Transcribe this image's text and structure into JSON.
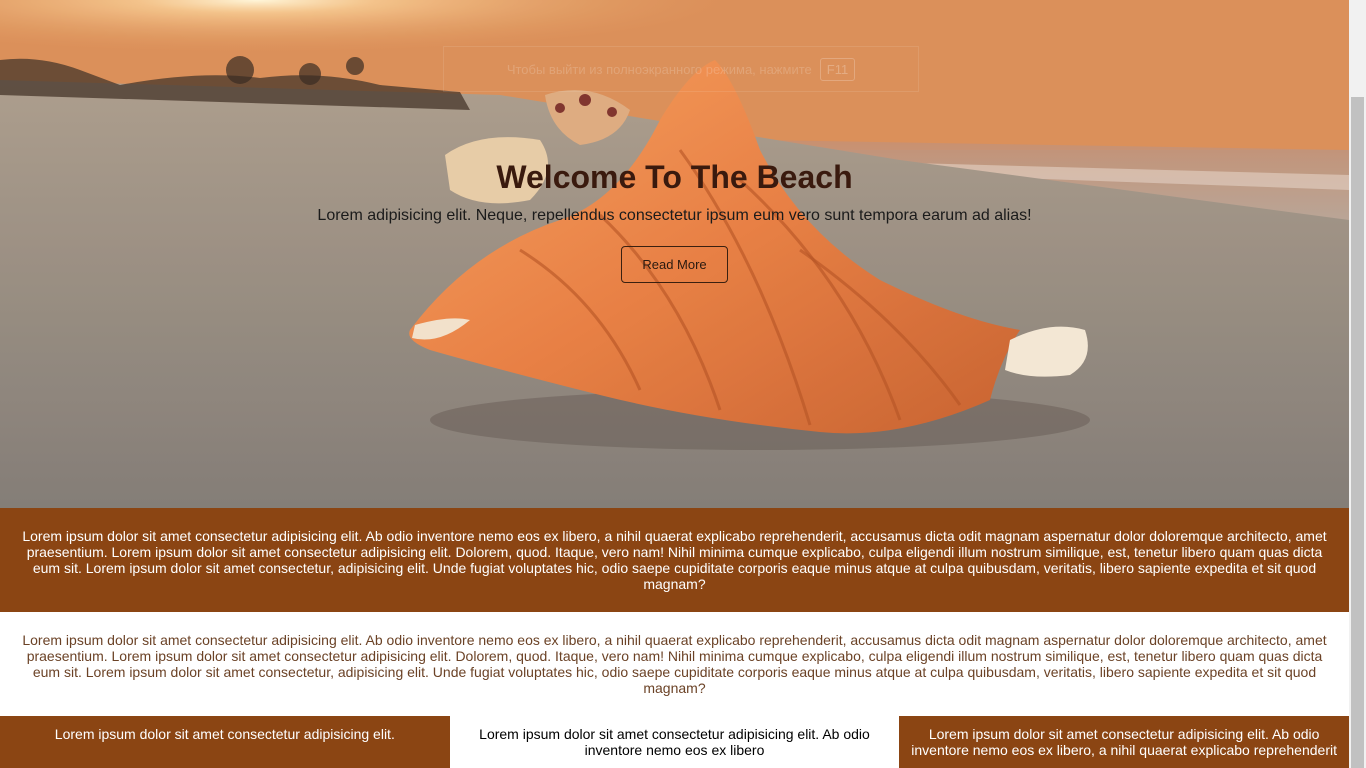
{
  "hero": {
    "notice_text": "Чтобы выйти из полноэкранного режима, нажмите",
    "notice_key": "F11",
    "title": "Welcome To The Beach",
    "subtitle": "Lorem adipisicing elit. Neque, repellendus consectetur ipsum eum vero sunt tempora earum ad alias!",
    "button_label": "Read More"
  },
  "sections": {
    "brown_text": "Lorem ipsum dolor sit amet consectetur adipisicing elit. Ab odio inventore nemo eos ex libero, a nihil quaerat explicabo reprehenderit, accusamus dicta odit magnam aspernatur dolor doloremque architecto, amet praesentium. Lorem ipsum dolor sit amet consectetur adipisicing elit. Dolorem, quod. Itaque, vero nam! Nihil minima cumque explicabo, culpa eligendi illum nostrum similique, est, tenetur libero quam quas dicta eum sit. Lorem ipsum dolor sit amet consectetur, adipisicing elit. Unde fugiat voluptates hic, odio saepe cupiditate corporis eaque minus atque at culpa quibusdam, veritatis, libero sapiente expedita et sit quod magnam?",
    "white_text": "Lorem ipsum dolor sit amet consectetur adipisicing elit. Ab odio inventore nemo eos ex libero, a nihil quaerat explicabo reprehenderit, accusamus dicta odit magnam aspernatur dolor doloremque architecto, amet praesentium. Lorem ipsum dolor sit amet consectetur adipisicing elit. Dolorem, quod. Itaque, vero nam! Nihil minima cumque explicabo, culpa eligendi illum nostrum similique, est, tenetur libero quam quas dicta eum sit. Lorem ipsum dolor sit amet consectetur, adipisicing elit. Unde fugiat voluptates hic, odio saepe cupiditate corporis eaque minus atque at culpa quibusdam, veritatis, libero sapiente expedita et sit quod magnam?"
  },
  "columns": [
    {
      "text": "Lorem ipsum dolor sit amet consectetur adipisicing elit."
    },
    {
      "text": "Lorem ipsum dolor sit amet consectetur adipisicing elit. Ab odio inventore nemo eos ex libero"
    },
    {
      "text": "Lorem ipsum dolor sit amet consectetur adipisicing elit. Ab odio inventore nemo eos ex libero, a nihil quaerat explicabo reprehenderit"
    }
  ],
  "colors": {
    "brown": "#8b4513",
    "white": "#ffffff",
    "title": "#3a1a0e"
  }
}
